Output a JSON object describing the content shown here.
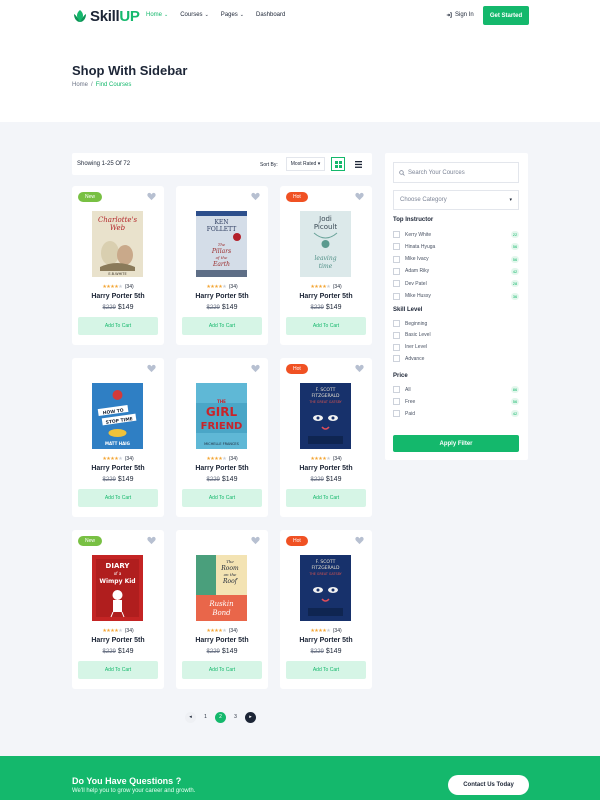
{
  "brand": {
    "name_prefix": "Skill",
    "name_suffix": "UP",
    "accent": "#14b86c"
  },
  "nav": {
    "items": [
      {
        "label": "Home",
        "has_menu": true,
        "active": true
      },
      {
        "label": "Courses",
        "has_menu": true,
        "active": false
      },
      {
        "label": "Pages",
        "has_menu": true,
        "active": false
      },
      {
        "label": "Dashboard",
        "has_menu": false,
        "active": false
      }
    ],
    "signin_label": "Sign In",
    "cta_label": "Get Started"
  },
  "page": {
    "title": "Shop With Sidebar",
    "breadcrumb": {
      "home": "Home",
      "separator": "/",
      "current": "Find Courses"
    }
  },
  "toolbar": {
    "showing": "Showing 1-25 Of 72",
    "sort_label": "Sort By:",
    "sort_value": "Most Rated"
  },
  "products": [
    {
      "badge": "New",
      "badge_type": "new",
      "cover": "charlotte",
      "stars": 4,
      "rating_count": "(34)",
      "name": "Harry Porter 5th",
      "old_price": "$229",
      "price": "$149",
      "cta": "Add To Cart"
    },
    {
      "badge": "",
      "badge_type": "",
      "cover": "pillars",
      "stars": 4,
      "rating_count": "(34)",
      "name": "Harry Porter 5th",
      "old_price": "$229",
      "price": "$149",
      "cta": "Add To Cart"
    },
    {
      "badge": "Hot",
      "badge_type": "hot",
      "cover": "leaving",
      "stars": 4,
      "rating_count": "(34)",
      "name": "Harry Porter 5th",
      "old_price": "$229",
      "price": "$149",
      "cta": "Add To Cart"
    },
    {
      "badge": "",
      "badge_type": "",
      "cover": "stop-time",
      "stars": 4,
      "rating_count": "(34)",
      "name": "Harry Porter 5th",
      "old_price": "$229",
      "price": "$149",
      "cta": "Add To Cart"
    },
    {
      "badge": "",
      "badge_type": "",
      "cover": "girlfriend",
      "stars": 4,
      "rating_count": "(34)",
      "name": "Harry Porter 5th",
      "old_price": "$229",
      "price": "$149",
      "cta": "Add To Cart"
    },
    {
      "badge": "Hot",
      "badge_type": "hot",
      "cover": "gatsby",
      "stars": 4,
      "rating_count": "(34)",
      "name": "Harry Porter 5th",
      "old_price": "$229",
      "price": "$149",
      "cta": "Add To Cart"
    },
    {
      "badge": "New",
      "badge_type": "new",
      "cover": "wimpy",
      "stars": 4,
      "rating_count": "(34)",
      "name": "Harry Porter 5th",
      "old_price": "$229",
      "price": "$149",
      "cta": "Add To Cart"
    },
    {
      "badge": "",
      "badge_type": "",
      "cover": "room-roof",
      "stars": 4,
      "rating_count": "(34)",
      "name": "Harry Porter 5th",
      "old_price": "$229",
      "price": "$149",
      "cta": "Add To Cart"
    },
    {
      "badge": "Hot",
      "badge_type": "hot",
      "cover": "gatsby",
      "stars": 4,
      "rating_count": "(34)",
      "name": "Harry Porter 5th",
      "old_price": "$229",
      "price": "$149",
      "cta": "Add To Cart"
    }
  ],
  "pagination": {
    "pages": [
      "1",
      "2",
      "3"
    ],
    "current": "2",
    "prev": "◂",
    "next": "▸"
  },
  "sidebar": {
    "search_placeholder": "Search Your Cources",
    "category_placeholder": "Choose Category",
    "instructor_heading": "Top Instructor",
    "instructors": [
      {
        "label": "Kerry White",
        "count": "22"
      },
      {
        "label": "Hinata Hyuga",
        "count": "56"
      },
      {
        "label": "Mike Ivacy",
        "count": "56"
      },
      {
        "label": "Adam Riky",
        "count": "42"
      },
      {
        "label": "Dev Patel",
        "count": "28"
      },
      {
        "label": "Mike Hussy",
        "count": "36"
      }
    ],
    "skill_heading": "Skill Level",
    "skills": [
      {
        "label": "Beginning"
      },
      {
        "label": "Basic Level"
      },
      {
        "label": "Iner Level"
      },
      {
        "label": "Advance"
      }
    ],
    "price_heading": "Price",
    "prices": [
      {
        "label": "All",
        "count": "86"
      },
      {
        "label": "Free",
        "count": "56"
      },
      {
        "label": "Paid",
        "count": "42"
      }
    ],
    "apply_label": "Apply Filter"
  },
  "cta": {
    "heading": "Do You Have Questions ?",
    "subtext": "We'll help you to grow your career and growth.",
    "button": "Contact Us Today"
  },
  "cover_text": {
    "charlotte": {
      "line1": "Charlotte's",
      "line2": "Web",
      "author": "E.B.WHITE"
    },
    "pillars": {
      "author1": "KEN",
      "author2": "FOLLETT",
      "title1": "The",
      "title2": "Pillars",
      "title3": "of the",
      "title4": "Earth"
    },
    "leaving": {
      "author1": "Jodi",
      "author2": "Picoult",
      "title1": "leaving",
      "title2": "time"
    },
    "stop_time": {
      "title1": "HOW TO",
      "title2": "STOP TIME",
      "author": "MATT HAIG"
    },
    "girlfriend": {
      "title1": "THE",
      "title2": "GIRL",
      "title3": "FRIEND",
      "author": "MICHELLE FRANCES"
    },
    "gatsby": {
      "author1": "F. SCOTT",
      "author2": "FITZGERALD",
      "title": "THE GREAT GATSBY"
    },
    "wimpy": {
      "title1": "DIARY",
      "title2": "of a",
      "title3": "Wimpy Kid"
    },
    "room_roof": {
      "title1": "The",
      "title2": "Room",
      "title3": "on the",
      "title4": "Roof",
      "author1": "Ruskin",
      "author2": "Bond"
    }
  }
}
